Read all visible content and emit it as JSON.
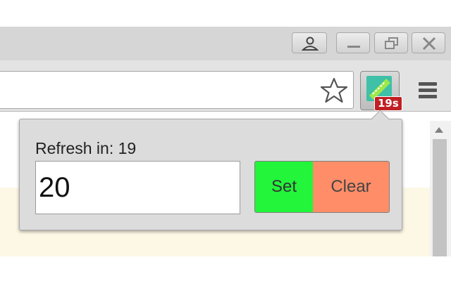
{
  "extension": {
    "badge_text": "19s",
    "icon": "refresh-ticket-icon"
  },
  "popup": {
    "refresh_label": "Refresh in: 19",
    "interval_value": "20",
    "set_label": "Set",
    "clear_label": "Clear"
  },
  "icons": {
    "profile": "profile-icon",
    "minimize": "minimize-icon",
    "restore": "restore-icon",
    "close": "close-icon",
    "bookmark": "star-icon",
    "menu": "hamburger-menu-icon"
  },
  "colors": {
    "set_button": "#22f53a",
    "clear_button": "#ff8d68",
    "badge": "#c01f24",
    "page_strip": "#fdf7e6"
  }
}
